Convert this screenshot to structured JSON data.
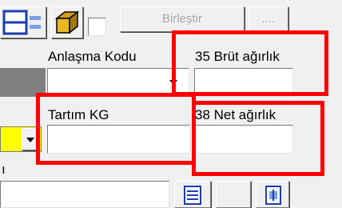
{
  "toolbar": {
    "merge_label": "Birleştir",
    "ellipsis_label": "...."
  },
  "form": {
    "agreement_code_label": "Anlaşma Kodu",
    "gross_weight_label": "35 Brüt ağırlık",
    "weigh_kg_label": "Tartım KG",
    "net_weight_label": "38 Net ağırlık",
    "agreement_code_value": "",
    "gross_weight_value": "",
    "weigh_kg_value": "",
    "net_weight_value": "",
    "left_small_label": "ı"
  },
  "colors": {
    "highlight": "#ff0000",
    "accent_yellow": "#ffff00",
    "gray_panel": "#808080",
    "window_bg": "#f0f0f0"
  },
  "icons": {
    "split_window": "split-window-icon",
    "box": "box-icon",
    "document_list": "document-list-icon",
    "document_new": "document-new-icon"
  }
}
